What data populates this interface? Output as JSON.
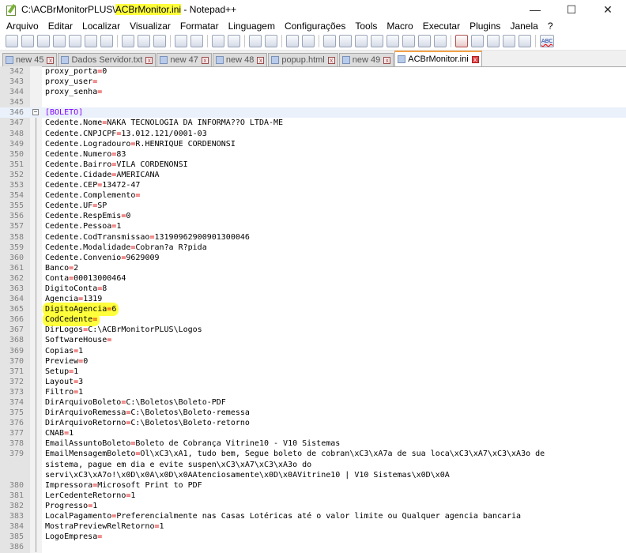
{
  "window": {
    "title_prefix": "C:\\ACBrMonitorPLUS\\",
    "title_highlight": "ACBrMonitor.ini",
    "title_suffix": " - Notepad++",
    "minimize": "—",
    "maximize": "☐",
    "close": "✕"
  },
  "menu": [
    "Arquivo",
    "Editar",
    "Localizar",
    "Visualizar",
    "Formatar",
    "Linguagem",
    "Configurações",
    "Tools",
    "Macro",
    "Executar",
    "Plugins",
    "Janela",
    "?"
  ],
  "toolbar": {
    "spell_label": "ABC"
  },
  "tabs": [
    {
      "label": "new 45",
      "active": false
    },
    {
      "label": "Dados Servidor.txt",
      "active": false
    },
    {
      "label": "new 47",
      "active": false
    },
    {
      "label": "new 48",
      "active": false
    },
    {
      "label": "popup.html",
      "active": false
    },
    {
      "label": "new 49",
      "active": false
    },
    {
      "label": "ACBrMonitor.ini",
      "active": true
    }
  ],
  "tab_close": "x",
  "lines": [
    {
      "n": "342",
      "k": "proxy_porta",
      "v": "0"
    },
    {
      "n": "343",
      "k": "proxy_user",
      "v": ""
    },
    {
      "n": "344",
      "k": "proxy_senha",
      "v": ""
    },
    {
      "n": "345",
      "text": ""
    },
    {
      "n": "346",
      "section": "[BOLETO]"
    },
    {
      "n": "347",
      "k": "Cedente.Nome",
      "v": "NAKA TECNOLOGIA DA INFORMA??O LTDA-ME"
    },
    {
      "n": "348",
      "k": "Cedente.CNPJCPF",
      "v": "13.012.121/0001-03"
    },
    {
      "n": "349",
      "k": "Cedente.Logradouro",
      "v": "R.HENRIQUE CORDENONSI"
    },
    {
      "n": "350",
      "k": "Cedente.Numero",
      "v": "83"
    },
    {
      "n": "351",
      "k": "Cedente.Bairro",
      "v": "VILA CORDENONSI"
    },
    {
      "n": "352",
      "k": "Cedente.Cidade",
      "v": "AMERICANA"
    },
    {
      "n": "353",
      "k": "Cedente.CEP",
      "v": "13472-47"
    },
    {
      "n": "354",
      "k": "Cedente.Complemento",
      "v": ""
    },
    {
      "n": "355",
      "k": "Cedente.UF",
      "v": "SP"
    },
    {
      "n": "356",
      "k": "Cedente.RespEmis",
      "v": "0"
    },
    {
      "n": "357",
      "k": "Cedente.Pessoa",
      "v": "1"
    },
    {
      "n": "358",
      "k": "Cedente.CodTransmissao",
      "v": "13190962900901300046"
    },
    {
      "n": "359",
      "k": "Cedente.Modalidade",
      "v": "Cobran?a R?pida"
    },
    {
      "n": "360",
      "k": "Cedente.Convenio",
      "v": "9629009"
    },
    {
      "n": "361",
      "k": "Banco",
      "v": "2"
    },
    {
      "n": "362",
      "k": "Conta",
      "v": "00013000464"
    },
    {
      "n": "363",
      "k": "DigitoConta",
      "v": "8"
    },
    {
      "n": "364",
      "k": "Agencia",
      "v": "1319"
    },
    {
      "n": "365",
      "k": "DigitoAgencia",
      "v": "6",
      "mark": true
    },
    {
      "n": "366",
      "k": "CodCedente",
      "v": "",
      "mark": true
    },
    {
      "n": "367",
      "k": "DirLogos",
      "v": "C:\\ACBrMonitorPLUS\\Logos"
    },
    {
      "n": "368",
      "k": "SoftwareHouse",
      "v": ""
    },
    {
      "n": "369",
      "k": "Copias",
      "v": "1"
    },
    {
      "n": "370",
      "k": "Preview",
      "v": "0"
    },
    {
      "n": "371",
      "k": "Setup",
      "v": "1"
    },
    {
      "n": "372",
      "k": "Layout",
      "v": "3"
    },
    {
      "n": "373",
      "k": "Filtro",
      "v": "1"
    },
    {
      "n": "374",
      "k": "DirArquivoBoleto",
      "v": "C:\\Boletos\\Boleto-PDF"
    },
    {
      "n": "375",
      "k": "DirArquivoRemessa",
      "v": "C:\\Boletos\\Boleto-remessa"
    },
    {
      "n": "376",
      "k": "DirArquivoRetorno",
      "v": "C:\\Boletos\\Boleto-retorno"
    },
    {
      "n": "377",
      "k": "CNAB",
      "v": "1"
    },
    {
      "n": "378",
      "k": "EmailAssuntoBoleto",
      "v": "Boleto de Cobrança Vitrine10 - V10 Sistemas"
    },
    {
      "n": "379",
      "k": "EmailMensagemBoleto",
      "v": "Ol\\xC3\\xA1, tudo bem, Segue boleto de cobran\\xC3\\xA7a de sua loca\\xC3\\xA7\\xC3\\xA3o de"
    },
    {
      "n": "",
      "text": "sistema, pague em dia e evite suspen\\xC3\\xA7\\xC3\\xA3o do"
    },
    {
      "n": "",
      "text": "servi\\xC3\\xA7o!\\x0D\\x0A\\x0D\\x0AAtenciosamente\\x0D\\x0AVitrine10 | V10 Sistemas\\x0D\\x0A"
    },
    {
      "n": "380",
      "k": "Impressora",
      "v": "Microsoft Print to PDF"
    },
    {
      "n": "381",
      "k": "LerCedenteRetorno",
      "v": "1"
    },
    {
      "n": "382",
      "k": "Progresso",
      "v": "1"
    },
    {
      "n": "383",
      "k": "LocalPagamento",
      "v": "Preferencialmente nas Casas Lotéricas até o valor limite ou Qualquer agencia bancaria"
    },
    {
      "n": "384",
      "k": "MostraPreviewRelRetorno",
      "v": "1"
    },
    {
      "n": "385",
      "k": "LogoEmpresa",
      "v": ""
    },
    {
      "n": "386",
      "text": ""
    }
  ]
}
